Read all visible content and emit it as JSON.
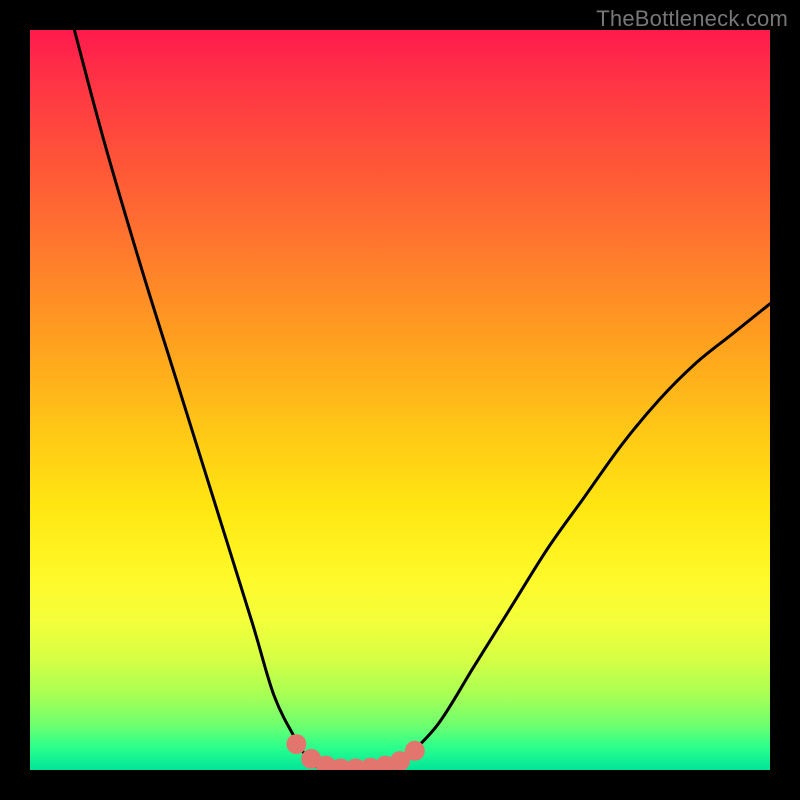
{
  "watermark": "TheBottleneck.com",
  "chart_data": {
    "type": "line",
    "title": "",
    "xlabel": "",
    "ylabel": "",
    "xlim": [
      0,
      100
    ],
    "ylim": [
      0,
      100
    ],
    "series": [
      {
        "name": "bottleneck-curve",
        "x": [
          6,
          10,
          15,
          20,
          25,
          30,
          33,
          36,
          38,
          40,
          42,
          45,
          48,
          50,
          55,
          60,
          65,
          70,
          75,
          80,
          85,
          90,
          95,
          100
        ],
        "y": [
          100,
          85,
          68,
          52,
          36,
          20,
          10,
          4,
          1,
          0,
          0,
          0,
          0,
          1,
          6,
          14,
          22,
          30,
          37,
          44,
          50,
          55,
          59,
          63
        ]
      }
    ],
    "marker_points": {
      "name": "trough-markers",
      "x": [
        36,
        38,
        40,
        42,
        44,
        46,
        48,
        50,
        52
      ],
      "y": [
        3.5,
        1.5,
        0.6,
        0.2,
        0.2,
        0.3,
        0.6,
        1.2,
        2.6
      ]
    },
    "gradient_stops": [
      {
        "pos": 0,
        "color": "#ff1a4d"
      },
      {
        "pos": 7,
        "color": "#ff3445"
      },
      {
        "pos": 18,
        "color": "#ff5538"
      },
      {
        "pos": 30,
        "color": "#ff7a2d"
      },
      {
        "pos": 42,
        "color": "#ffa01f"
      },
      {
        "pos": 54,
        "color": "#ffc716"
      },
      {
        "pos": 65,
        "color": "#ffe812"
      },
      {
        "pos": 74,
        "color": "#fff92a"
      },
      {
        "pos": 80,
        "color": "#f2ff3a"
      },
      {
        "pos": 85,
        "color": "#d6ff44"
      },
      {
        "pos": 90,
        "color": "#a6ff55"
      },
      {
        "pos": 94,
        "color": "#6dff70"
      },
      {
        "pos": 97,
        "color": "#2aff8c"
      },
      {
        "pos": 100,
        "color": "#00e59a"
      }
    ],
    "colors": {
      "curve": "#000000",
      "marker": "#e2766f",
      "frame": "#000000"
    }
  }
}
